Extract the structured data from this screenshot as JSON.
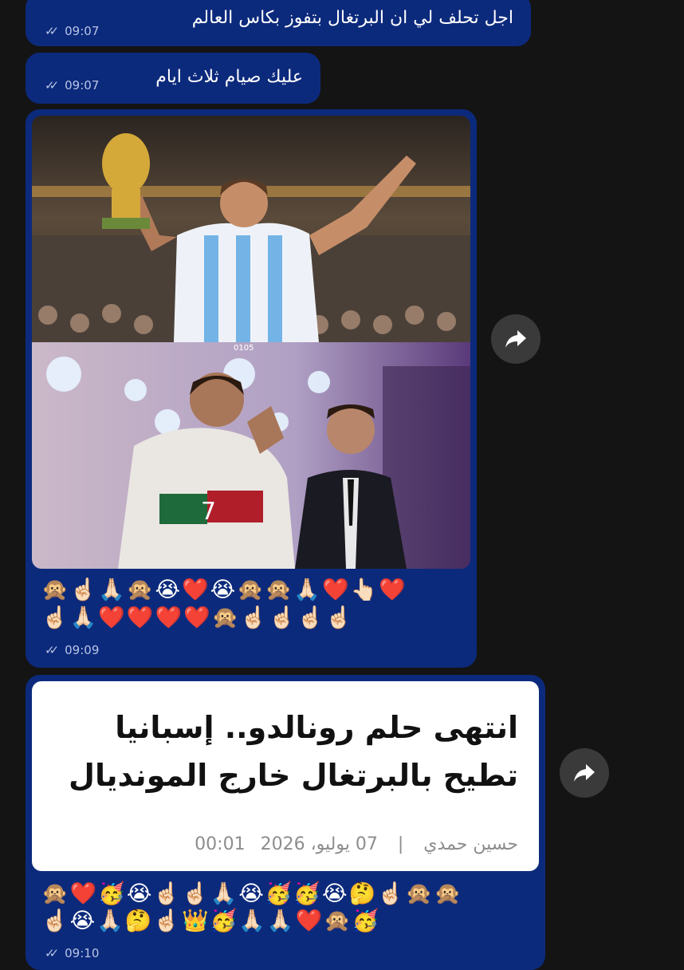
{
  "messages": [
    {
      "text": "اجل تحلف لي ان البرتغال بتفوز بكاس العالم",
      "time": "09:07"
    },
    {
      "text": "عليك صيام ثلاث ايام",
      "time": "09:07"
    }
  ],
  "photo_message": {
    "watermark": "0105",
    "jersey_number": "7",
    "emoji_line_1": "🙊☝🏻🙏🏻🙊😭❤️😭🙊🙊🙏🏻❤️👆🏻❤️",
    "emoji_line_2": "☝🏻🙏🏻❤️❤️❤️❤️🙊☝🏻☝🏻☝🏻☝🏻",
    "time": "09:09"
  },
  "news_message": {
    "headline_line_1": "انتهى حلم رونالدو.. إسبانيا",
    "headline_line_2": "تطيح بالبرتغال خارج المونديال",
    "author": "حسين حمدي",
    "separator": "|",
    "date": "07 يوليو، 2026",
    "clock": "00:01",
    "emoji_line_1": "🙊❤️🥳😭☝🏻☝🏻🙏🏻😭🥳🥳😭🤔☝🏻🙊🙊",
    "emoji_line_2": "☝🏻😭🙏🏻🤔☝🏻👑🥳🙏🏻🙏🏻❤️🙊🥳",
    "time": "09:10"
  },
  "icons": {
    "forward": "forward-arrow-icon",
    "read_receipt": "double-check-icon"
  },
  "colors": {
    "background": "#141414",
    "bubble": "#0c2a7c",
    "card": "#ffffff",
    "forward_button": "#3a3a3a"
  }
}
